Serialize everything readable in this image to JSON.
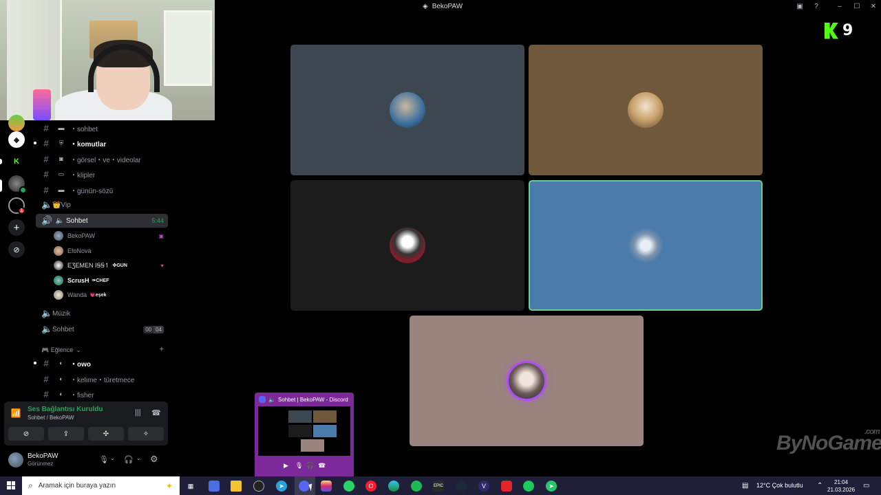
{
  "window": {
    "title": "BekoPAW"
  },
  "channels": [
    {
      "label": "・sohbet",
      "icon": "chat-icon",
      "bold": false
    },
    {
      "label": "・komutlar",
      "icon": "shield-icon",
      "bold": true
    },
    {
      "label": "・görsel・ve・videolar",
      "icon": "camera-icon",
      "bold": false
    },
    {
      "label": "・klipler",
      "icon": "film-icon",
      "bold": false
    },
    {
      "label": "・günün-sözü",
      "icon": "chat-icon",
      "bold": false
    }
  ],
  "voice_channels": {
    "vip": "👑Vip",
    "sohbet_active": "Sohbet",
    "sohbet_active_duration": "5:44",
    "muzik": "Müzik",
    "sohbet2": "Sohbet",
    "sohbet2_count_a": "00",
    "sohbet2_count_b": "04"
  },
  "voice_users": [
    {
      "name": "BekoPAW",
      "tag": "",
      "bold": false
    },
    {
      "name": "EfoNova",
      "tag": "",
      "bold": false
    },
    {
      "name": "ΕƷΕΜΕΝ ΙꞨꞨ↿",
      "tag": "✜GUN",
      "bold": false
    },
    {
      "name": "ScrusH",
      "tag": "✑CHEF",
      "bold": true
    },
    {
      "name": "Wanda",
      "tag": "💗eşek",
      "bold": false
    }
  ],
  "category": {
    "label": "🎮 Eğlence"
  },
  "fun_channels": [
    {
      "label": "・owo",
      "bold": true
    },
    {
      "label": "・kelime・türetmece",
      "bold": false
    },
    {
      "label": "・fisher",
      "bold": false
    }
  ],
  "voice_panel": {
    "status": "Ses Bağlantısı Kuruldu",
    "location": "Sohbet / BekoPAW"
  },
  "user": {
    "name": "BekoPAW",
    "status": "Görünmez"
  },
  "grid_colors": {
    "tile1": "#3d4752",
    "tile2": "#6f583b",
    "tile3": "#1c1c1c",
    "tile4": "#4a7bab",
    "tile5": "#9a847d",
    "speaking_border": "#65d08f"
  },
  "overlay": {
    "k9_number": "9",
    "watermark": "ByNoGame",
    "watermark_suffix": ".com"
  },
  "preview": {
    "title": "Sohbet | BekoPAW - Discord"
  },
  "taskbar": {
    "search_placeholder": "Aramak için buraya yazın",
    "weather": "12°C  Çok bulutlu",
    "time": "21:04",
    "date": "21.03.2026"
  }
}
